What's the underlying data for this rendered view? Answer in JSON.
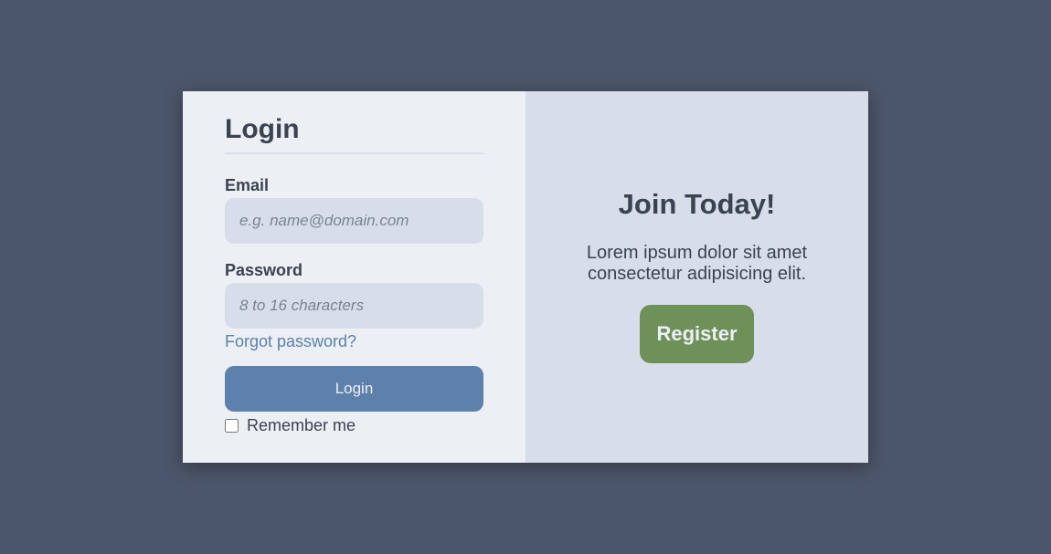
{
  "login": {
    "title": "Login",
    "email_label": "Email",
    "email_placeholder": "e.g. name@domain.com",
    "password_label": "Password",
    "password_placeholder": "8 to 16 characters",
    "forgot_link": "Forgot password?",
    "login_button": "Login",
    "remember_label": "Remember me",
    "remember_checked": false
  },
  "register": {
    "title": "Join Today!",
    "text": "Lorem ipsum dolor sit amet consectetur adipisicing elit.",
    "button": "Register"
  },
  "colors": {
    "page_background": "#4c566a",
    "login_panel": "#eceff4",
    "register_panel": "#d8dee9",
    "accent_blue": "#5e81ac",
    "register_green": "#6e9159",
    "text_dark": "#3b4252"
  }
}
